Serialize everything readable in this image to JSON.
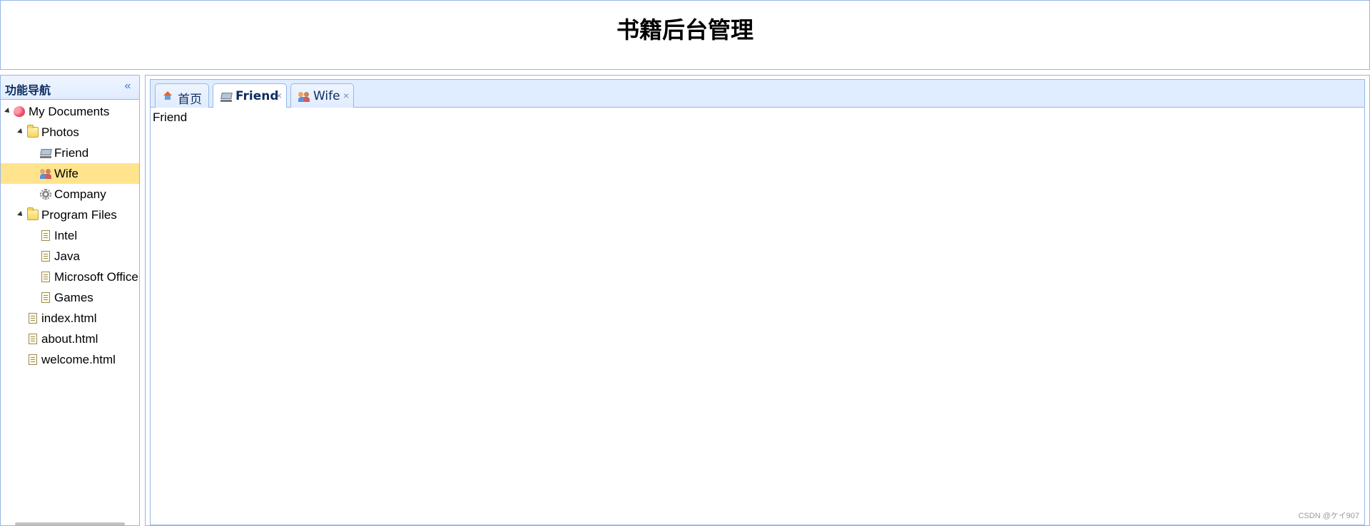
{
  "header": {
    "title": "书籍后台管理"
  },
  "west": {
    "title": "功能导航",
    "collapse_icon": "double-chevron-left-icon",
    "tree": [
      {
        "label": "My Documents",
        "icon": "heart-icon",
        "level": 0,
        "expanded": true
      },
      {
        "label": "Photos",
        "icon": "folder-icon",
        "level": 1,
        "expanded": true
      },
      {
        "label": "Friend",
        "icon": "cart-icon",
        "level": 2
      },
      {
        "label": "Wife",
        "icon": "users-icon",
        "level": 2,
        "selected": true
      },
      {
        "label": "Company",
        "icon": "gear-icon",
        "level": 2
      },
      {
        "label": "Program Files",
        "icon": "folder-icon",
        "level": 1,
        "expanded": true
      },
      {
        "label": "Intel",
        "icon": "file-icon",
        "level": 2
      },
      {
        "label": "Java",
        "icon": "file-icon",
        "level": 2
      },
      {
        "label": "Microsoft Office",
        "icon": "file-icon",
        "level": 2
      },
      {
        "label": "Games",
        "icon": "file-icon",
        "level": 2
      },
      {
        "label": "index.html",
        "icon": "file-icon",
        "level": 1
      },
      {
        "label": "about.html",
        "icon": "file-icon",
        "level": 1
      },
      {
        "label": "welcome.html",
        "icon": "file-icon",
        "level": 1
      }
    ]
  },
  "tabs": [
    {
      "label": "首页",
      "icon": "home-icon",
      "closable": false
    },
    {
      "label": "Friend",
      "icon": "cart-icon",
      "closable": true,
      "active": true
    },
    {
      "label": "Wife",
      "icon": "users-icon",
      "closable": true
    }
  ],
  "content": {
    "text": "Friend"
  },
  "watermark": "CSDN @ケイ907",
  "colors": {
    "border": "#95b8e7",
    "header_bg": "#e0ecff",
    "selected": "#ffe48d"
  }
}
